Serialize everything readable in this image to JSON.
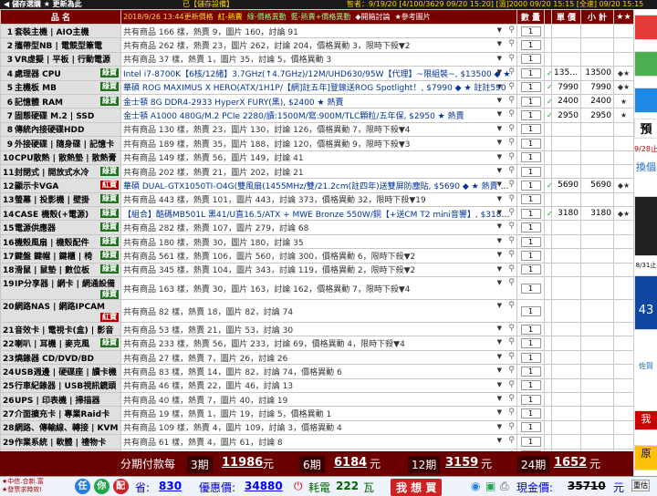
{
  "topbar": {
    "buttons": "◀ 儲存選購   ★ 更新為此",
    "hint": "已【儲存設備】",
    "tickers": "智者：9/19/20    [4/100/3629 09/20 15:20]   [溫]2000 09/20 15:15   [全速] 09/20 15:15"
  },
  "header": {
    "col_name": "品  名",
    "timestamp": "2018/9/26 13:44更新價格",
    "legend_red": "紅-熱賣",
    "legend_green": "綠-價格異動",
    "legend_blue": "藍-熱賣+價格異動",
    "legend_new": "◆開箱討論",
    "legend_ref": "★參考圖片",
    "col_qty": "數 量",
    "col_price": "單 價",
    "col_subtotal": "小 計",
    "col_star": "★★"
  },
  "rows": [
    {
      "num": "1",
      "cat": "套裝主機 | AIO主機",
      "tag": "",
      "product": "共有商品 166 樣，熱賣 9，圖片 160，討論 91",
      "qty": "1",
      "mk": "",
      "price": "",
      "sub": "",
      "act": ""
    },
    {
      "num": "2",
      "cat": "攜帶型NB | 電競型筆電",
      "tag": "",
      "product": "共有商品 262 樣，熱賣 23，圖片 262，討論 204，價格異動 3，限時下殺▼2",
      "qty": "1",
      "mk": "",
      "price": "",
      "sub": "",
      "act": ""
    },
    {
      "num": "3",
      "cat": "VR虛擬 | 平板 | 行動電源",
      "tag": "",
      "product": "共有商品 37 樣，熱賣 1，圖片 35，討論 5，價格異動 3",
      "qty": "1",
      "mk": "",
      "price": "",
      "sub": "",
      "act": ""
    },
    {
      "num": "4",
      "cat": "處理器 CPU",
      "tag": "綠寶",
      "product": "Intel i7-8700K【6核/12緒】3.7GHz(↑4.7GHz)/12M/UHD630/95W【代理】~限組裝~, $13500 ◆ ★",
      "qty": "1",
      "mk": "✓",
      "price": "13500",
      "sub": "13500",
      "act": "◆★"
    },
    {
      "num": "5",
      "cat": "主機板 MB",
      "tag": "綠寶",
      "product": "華碩 ROG MAXIMUS X HERO(ATX/1H1P/【網]註五年]登錄送ROG Spotlight！, $7990 ◆ ★ 註註590",
      "qty": "1",
      "mk": "✓",
      "price": "7990",
      "sub": "7990",
      "act": "◆★"
    },
    {
      "num": "6",
      "cat": "記憶體 RAM",
      "tag": "綠寶",
      "product": "金士頓 8G DDR4-2933 HyperX FURY(黑), $2400 ★ 熱賣",
      "qty": "1",
      "mk": "✓",
      "price": "2400",
      "sub": "2400",
      "act": "★"
    },
    {
      "num": "7",
      "cat": "固態硬碟 M.2 | SSD",
      "tag": "",
      "product": "金士頓 A1000 480G/M.2 PCIe 2280/讀:1500M/寫:900M/TLC顆粒/五年保, $2950 ★ 熱賣",
      "qty": "1",
      "mk": "✓",
      "price": "2950",
      "sub": "2950",
      "act": "★"
    },
    {
      "num": "8",
      "cat": "傳統內接硬碟HDD",
      "tag": "",
      "product": "共有商品 130 樣，熱賣 23，圖片 130，討論 126，價格異動 7，限時下殺▼4",
      "qty": "1",
      "mk": "",
      "price": "",
      "sub": "",
      "act": ""
    },
    {
      "num": "9",
      "cat": "外接硬碟 | 隨身碟 | 記憶卡",
      "tag": "",
      "product": "共有商品 189 樣，熱賣 35，圖片 188，討論 120，價格異動 9，限時下殺▼3",
      "qty": "1",
      "mk": "",
      "price": "",
      "sub": "",
      "act": ""
    },
    {
      "num": "10",
      "cat": "CPU散熱 | 散熱墊 | 散熱膏",
      "tag": "",
      "product": "共有商品 149 樣，熱賣 56，圖片 149，討論 41",
      "qty": "1",
      "mk": "",
      "price": "",
      "sub": "",
      "act": ""
    },
    {
      "num": "11",
      "cat": "封閉式 | 開放式水冷",
      "tag": "綠寶",
      "product": "共有商品 202 樣，熱賣 21，圖片 202，討論 21",
      "qty": "1",
      "mk": "",
      "price": "",
      "sub": "",
      "act": ""
    },
    {
      "num": "12",
      "cat": "顯示卡VGA",
      "tag": "紅寶",
      "product": "華碩 DUAL-GTX1050TI-O4G(雙風扇(1455MHz/雙/21.2cm(註四年)送雙屏防塵貼, $5690 ◆ ★ 熱賣 ，註註2",
      "qty": "1",
      "mk": "✓",
      "price": "5690",
      "sub": "5690",
      "act": "◆★"
    },
    {
      "num": "13",
      "cat": "螢幕 | 投影機 | 壁掛",
      "tag": "綠寶",
      "product": "共有商品 443 樣，熱賣 101，圖片 443，討論 373，價格異動 32，限時下殺▼19",
      "qty": "1",
      "mk": "",
      "price": "",
      "sub": "",
      "act": ""
    },
    {
      "num": "14",
      "cat": "CASE 機殼(+電源)",
      "tag": "綠寶",
      "product": "【組合】酷碼MB501L 黑41/U直16.5/ATX + MWE Bronze 550W/銅【+送CM T2 mini音響】, $3180 ◆ ★ 熱",
      "qty": "1",
      "mk": "✓",
      "price": "3180",
      "sub": "3180",
      "act": "◆★"
    },
    {
      "num": "15",
      "cat": "電源供應器",
      "tag": "綠寶",
      "product": "共有商品 282 樣，熱賣 107，圖片 279，討論 68",
      "qty": "1",
      "mk": "",
      "price": "",
      "sub": "",
      "act": ""
    },
    {
      "num": "16",
      "cat": "機殼風扇 | 機殼配件",
      "tag": "綠寶",
      "product": "共有商品 180 樣，熱賣 30，圖片 180，討論 35",
      "qty": "1",
      "mk": "",
      "price": "",
      "sub": "",
      "act": ""
    },
    {
      "num": "17",
      "cat": "鍵盤 鍵帽 | 鍵櫃 | 椅",
      "tag": "綠寶",
      "product": "共有商品 561 樣，熱賣 106，圖片 560，討論 300，價格異動 6，限時下殺▼2",
      "qty": "1",
      "mk": "",
      "price": "",
      "sub": "",
      "act": ""
    },
    {
      "num": "18",
      "cat": "滑鼠 | 鼠墊 | 數位板",
      "tag": "綠寶",
      "product": "共有商品 345 樣，熱賣 104，圖片 343，討論 119，價格異動 2，限時下殺▼2",
      "qty": "1",
      "mk": "",
      "price": "",
      "sub": "",
      "act": ""
    },
    {
      "num": "19",
      "cat": "IP分享器 | 網卡 | 網通設備",
      "tag": "綠寶",
      "product": "共有商品 163 樣，熱賣 30，圖片 163，討論 162，價格異動 7，限時下殺▼4",
      "qty": "1",
      "mk": "",
      "price": "",
      "sub": "",
      "act": ""
    },
    {
      "num": "20",
      "cat": "網路NAS | 網路IPCAM",
      "tag": "紅寶",
      "product": "共有商品 82 樣，熱賣 18，圖片 82，討論 74",
      "qty": "1",
      "mk": "",
      "price": "",
      "sub": "",
      "act": ""
    },
    {
      "num": "21",
      "cat": "音效卡 | 電視卡(盒) | 影音",
      "tag": "",
      "product": "共有商品 53 樣，熱賣 21，圖片 53，討論 30",
      "qty": "1",
      "mk": "",
      "price": "",
      "sub": "",
      "act": ""
    },
    {
      "num": "22",
      "cat": "喇叭 | 耳機 | 麥克風",
      "tag": "綠寶",
      "product": "共有商品 233 樣，熱賣 56，圖片 233，討論 69，價格異動 4，限時下殺▼4",
      "qty": "1",
      "mk": "",
      "price": "",
      "sub": "",
      "act": ""
    },
    {
      "num": "23",
      "cat": "燒錄器 CD/DVD/BD",
      "tag": "",
      "product": "共有商品 27 樣，熱賣 7，圖片 26，討論 26",
      "qty": "1",
      "mk": "",
      "price": "",
      "sub": "",
      "act": ""
    },
    {
      "num": "24",
      "cat": "USB週邊 | 硬碟座 | 讀卡機",
      "tag": "",
      "product": "共有商品 83 樣，熱賣 14，圖片 82，討論 74，價格異動 6",
      "qty": "1",
      "mk": "",
      "price": "",
      "sub": "",
      "act": ""
    },
    {
      "num": "25",
      "cat": "行車紀錄器 | USB視訊鏡頭",
      "tag": "",
      "product": "共有商品 46 樣，熱賣 22，圖片 46，討論 13",
      "qty": "1",
      "mk": "",
      "price": "",
      "sub": "",
      "act": ""
    },
    {
      "num": "26",
      "cat": "UPS | 印表機 | 掃描器",
      "tag": "",
      "product": "共有商品 40 樣，熱賣 7，圖片 40，討論 19",
      "qty": "1",
      "mk": "",
      "price": "",
      "sub": "",
      "act": ""
    },
    {
      "num": "27",
      "cat": "介面擴充卡 | 專業Raid卡",
      "tag": "",
      "product": "共有商品 19 樣，熱賣 1，圖片 19，討論 5，價格異動 1",
      "qty": "1",
      "mk": "",
      "price": "",
      "sub": "",
      "act": ""
    },
    {
      "num": "28",
      "cat": "網路、傳輸線、轉接 | KVM",
      "tag": "",
      "product": "共有商品 109 樣，熱賣 4，圖片 109，討論 3，價格異動 4",
      "qty": "1",
      "mk": "",
      "price": "",
      "sub": "",
      "act": ""
    },
    {
      "num": "29",
      "cat": "作業系統 | 軟體 | 禮物卡",
      "tag": "",
      "product": "共有商品 61 樣，熱賣 4，圖片 61，討論 8",
      "qty": "1",
      "mk": "",
      "price": "",
      "sub": "",
      "act": ""
    },
    {
      "num": "30",
      "cat": "福利品出清",
      "tag": "",
      "product": "共有商品 50 樣，熱賣 2，圖片 50，討論 6，價格異動 2",
      "qty": "1",
      "mk": "",
      "price": "",
      "sub": "",
      "act": ""
    }
  ],
  "summary": {
    "label": "分期付款每",
    "p3": "3期",
    "p3_amt": "11986",
    "unit": "元",
    "p6": "6期",
    "p6_amt": "6184",
    "p12": "12期",
    "p12_amt": "3159",
    "p24": "24期",
    "p24_amt": "1652"
  },
  "bottom": {
    "notes": "★中信.合新.富\n★發票求時效!",
    "b1": "任",
    "b2": "你",
    "b3": "配",
    "save_label": "省:",
    "save_amt": "830",
    "discount_label": "優惠價:",
    "discount_amt": "34880",
    "power_label": "耗電",
    "power_amt": "222",
    "power_unit": "瓦",
    "buy_label": "我 想 買",
    "cash_label": "現金價:",
    "cash_amt": "35710",
    "cash_unit": "元",
    "reset_label": "重估"
  },
  "side": {
    "d1": "9/28止",
    "d2": "換個",
    "d3": "8/31止",
    "d4": "43",
    "d5": "佐賀",
    "d6": "我",
    "d7": "原"
  },
  "colors": {
    "header_bg": "#7a0000",
    "summary_bg": "#6b0000",
    "tag_green": "#1f6f1f",
    "tag_red": "#b00000"
  }
}
